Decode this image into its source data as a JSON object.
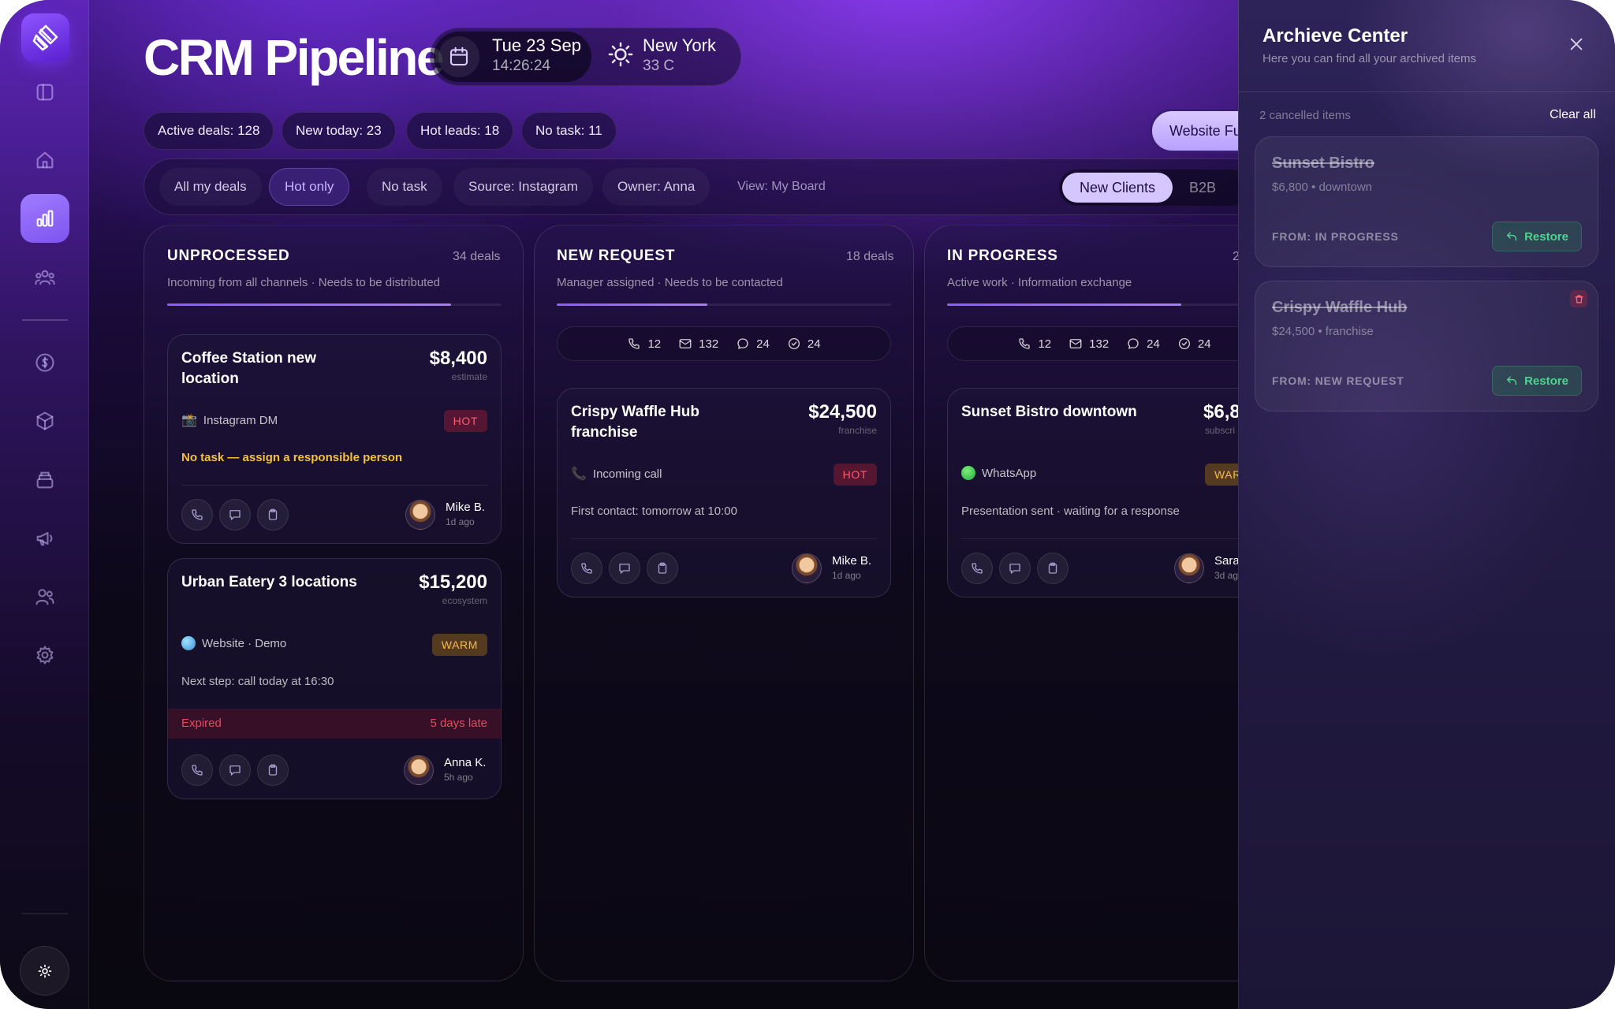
{
  "app": {
    "title": "CRM Pipeline"
  },
  "header": {
    "date": "Tue 23 Sep",
    "time": "14:26:24",
    "city": "New York",
    "temperature": "33 C"
  },
  "stats": [
    "Active deals: 128",
    "New today: 23",
    "Hot leads: 18",
    "No task: 11"
  ],
  "website_button": "Website Fu",
  "filters": {
    "items": [
      "All my deals",
      "Hot only",
      "No task",
      "Source: Instagram",
      "Owner: Anna"
    ],
    "view_label": "View: My Board",
    "segment_active": "New Clients",
    "segment_other": "B2B"
  },
  "counters": {
    "calls": "12",
    "emails": "132",
    "chats": "24",
    "tasks": "24"
  },
  "columns": [
    {
      "title": "UNPROCESSED",
      "count": "34 deals",
      "subtitle": "Incoming from all channels · Needs to be distributed",
      "progress": 0.85,
      "cards": [
        {
          "title": "Coffee Station new location",
          "amount": "$8,400",
          "amount_note": "estimate",
          "source": "Instagram DM",
          "badge": "HOT",
          "note": "No task — assign a responsible person",
          "owner": "Mike B.",
          "time": "1d ago"
        },
        {
          "title": "Urban Eatery 3 locations",
          "amount": "$15,200",
          "amount_note": "ecosystem",
          "source": "Website · Demo",
          "badge": "WARM",
          "note": "Next step: call today at 16:30",
          "expired": "Expired",
          "late": "5 days late",
          "owner": "Anna K.",
          "time": "5h ago"
        }
      ]
    },
    {
      "title": "NEW REQUEST",
      "count": "18 deals",
      "subtitle": "Manager assigned · Needs to be contacted",
      "progress": 0.45,
      "cards": [
        {
          "title": "Crispy Waffle Hub franchise",
          "amount": "$24,500",
          "amount_note": "franchise",
          "source": "Incoming call",
          "badge": "HOT",
          "note": "First contact: tomorrow at 10:00",
          "owner": "Mike B.",
          "time": "1d ago"
        }
      ]
    },
    {
      "title": "IN PROGRESS",
      "count": "2",
      "subtitle": "Active work · Information exchange",
      "progress": 0.7,
      "cards": [
        {
          "title": "Sunset Bistro downtown",
          "amount": "$6,8",
          "amount_note": "subscri",
          "source": "WhatsApp",
          "badge": "WAR",
          "note": "Presentation sent · waiting for a response",
          "owner": "Sara",
          "time": "3d ag"
        }
      ]
    }
  ],
  "archive": {
    "title": "Archieve Center",
    "subtitle": "Here you can find all your archived items",
    "count_label": "2 cancelled items",
    "clear_all": "Clear all",
    "items": [
      {
        "title": "Sunset Bistro",
        "sub": "$6,800 • downtown",
        "from": "FROM: IN PROGRESS",
        "restore": "Restore"
      },
      {
        "title": "Crispy Waffle Hub",
        "sub": "$24,500 • franchise",
        "from": "FROM: NEW REQUEST",
        "restore": "Restore"
      }
    ]
  },
  "colors": {
    "accent": "#8c5cff",
    "hot": "#ff5a6e",
    "warm": "#f6b94a",
    "restore": "#4fd28f",
    "warning": "#f5c13c"
  }
}
